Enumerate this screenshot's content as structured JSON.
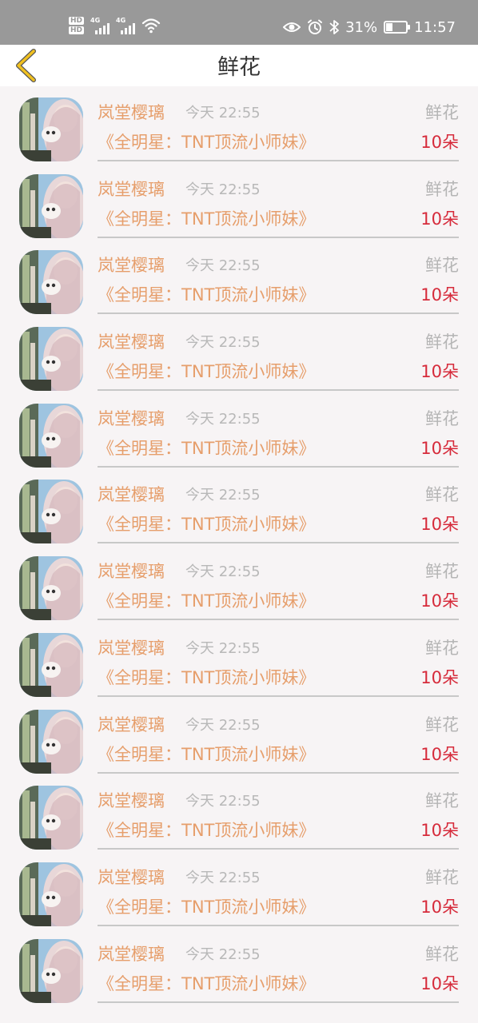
{
  "status_bar": {
    "hd1": "HD",
    "hd2": "HD",
    "net1": "4G",
    "net2": "4G",
    "battery_percent": "31%",
    "battery_level": 0.31,
    "time": "11:57",
    "icons": [
      "eye-icon",
      "alarm-icon",
      "bluetooth-icon",
      "wifi-icon",
      "battery-icon"
    ]
  },
  "header": {
    "title": "鲜花",
    "back_icon": "chevron-left-icon",
    "accent_color": "#f0c020"
  },
  "colors": {
    "username": "#e69e6b",
    "count": "#d62b3b",
    "muted": "#b5b5b5"
  },
  "records": [
    {
      "user": "岚堂樱璃",
      "time": "今天 22:55",
      "gift": "鲜花",
      "book": "《全明星：TNT顶流小师妹》",
      "count": "10朵"
    },
    {
      "user": "岚堂樱璃",
      "time": "今天 22:55",
      "gift": "鲜花",
      "book": "《全明星：TNT顶流小师妹》",
      "count": "10朵"
    },
    {
      "user": "岚堂樱璃",
      "time": "今天 22:55",
      "gift": "鲜花",
      "book": "《全明星：TNT顶流小师妹》",
      "count": "10朵"
    },
    {
      "user": "岚堂樱璃",
      "time": "今天 22:55",
      "gift": "鲜花",
      "book": "《全明星：TNT顶流小师妹》",
      "count": "10朵"
    },
    {
      "user": "岚堂樱璃",
      "time": "今天 22:55",
      "gift": "鲜花",
      "book": "《全明星：TNT顶流小师妹》",
      "count": "10朵"
    },
    {
      "user": "岚堂樱璃",
      "time": "今天 22:55",
      "gift": "鲜花",
      "book": "《全明星：TNT顶流小师妹》",
      "count": "10朵"
    },
    {
      "user": "岚堂樱璃",
      "time": "今天 22:55",
      "gift": "鲜花",
      "book": "《全明星：TNT顶流小师妹》",
      "count": "10朵"
    },
    {
      "user": "岚堂樱璃",
      "time": "今天 22:55",
      "gift": "鲜花",
      "book": "《全明星：TNT顶流小师妹》",
      "count": "10朵"
    },
    {
      "user": "岚堂樱璃",
      "time": "今天 22:55",
      "gift": "鲜花",
      "book": "《全明星：TNT顶流小师妹》",
      "count": "10朵"
    },
    {
      "user": "岚堂樱璃",
      "time": "今天 22:55",
      "gift": "鲜花",
      "book": "《全明星：TNT顶流小师妹》",
      "count": "10朵"
    },
    {
      "user": "岚堂樱璃",
      "time": "今天 22:55",
      "gift": "鲜花",
      "book": "《全明星：TNT顶流小师妹》",
      "count": "10朵"
    },
    {
      "user": "岚堂樱璃",
      "time": "今天 22:55",
      "gift": "鲜花",
      "book": "《全明星：TNT顶流小师妹》",
      "count": "10朵"
    }
  ]
}
